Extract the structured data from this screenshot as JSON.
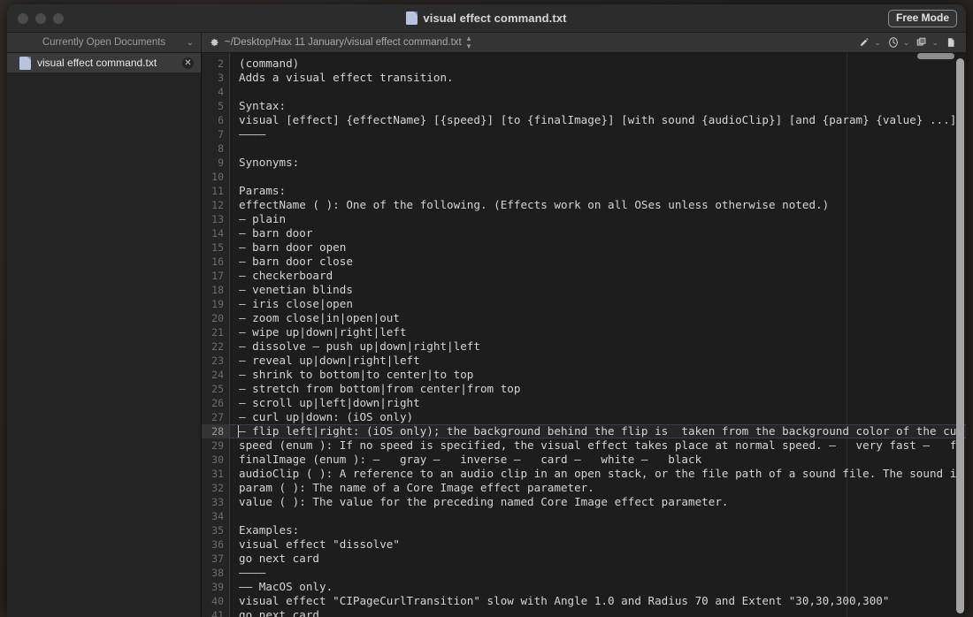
{
  "window": {
    "title": "visual effect command.txt",
    "title_icon": "document-icon",
    "traffic_lights": [
      "close-button",
      "minimize-button",
      "zoom-button"
    ],
    "free_mode_label": "Free Mode"
  },
  "toolbar": {
    "sidebar_header_label": "Currently Open Documents",
    "sidebar_header_chevron": "⌄",
    "gear_icon": "gear-icon",
    "path": "~/Desktop/Hax 11 January/visual effect command.txt",
    "path_stepper": "⌃⌄",
    "icons": [
      {
        "name": "marker-icon",
        "chevron": "⌄"
      },
      {
        "name": "history-clock-icon",
        "chevron": "⌄"
      },
      {
        "name": "copy-windows-icon",
        "chevron": "⌄"
      },
      {
        "name": "new-document-icon",
        "chevron": ""
      }
    ]
  },
  "sidebar": {
    "items": [
      {
        "label": "visual effect command.txt",
        "icon": "document-icon",
        "close": "✕",
        "selected": true
      }
    ]
  },
  "editor": {
    "first_line_number": 2,
    "active_line_number": 28,
    "lines": [
      {
        "n": 2,
        "text": "(command)"
      },
      {
        "n": 3,
        "text": "Adds a visual effect transition."
      },
      {
        "n": 4,
        "text": ""
      },
      {
        "n": 5,
        "text": "Syntax:"
      },
      {
        "n": 6,
        "text": "visual [effect] {effectName} [{speed}] [to {finalImage}] [with sound {audioClip}] [and {param} {value} ...]"
      },
      {
        "n": 7,
        "text": "————"
      },
      {
        "n": 8,
        "text": ""
      },
      {
        "n": 9,
        "text": "Synonyms:"
      },
      {
        "n": 10,
        "text": ""
      },
      {
        "n": 11,
        "text": "Params:"
      },
      {
        "n": 12,
        "text": "effectName ( ): One of the following. (Effects work on all OSes unless otherwise noted.)"
      },
      {
        "n": 13,
        "text": "— plain"
      },
      {
        "n": 14,
        "text": "— barn door"
      },
      {
        "n": 15,
        "text": "— barn door open"
      },
      {
        "n": 16,
        "text": "— barn door close"
      },
      {
        "n": 17,
        "text": "— checkerboard"
      },
      {
        "n": 18,
        "text": "— venetian blinds"
      },
      {
        "n": 19,
        "text": "— iris close|open"
      },
      {
        "n": 20,
        "text": "— zoom close|in|open|out"
      },
      {
        "n": 21,
        "text": "— wipe up|down|right|left"
      },
      {
        "n": 22,
        "text": "— dissolve — push up|down|right|left"
      },
      {
        "n": 23,
        "text": "— reveal up|down|right|left"
      },
      {
        "n": 24,
        "text": "— shrink to bottom|to center|to top"
      },
      {
        "n": 25,
        "text": "— stretch from bottom|from center|from top"
      },
      {
        "n": 26,
        "text": "— scroll up|left|down|right"
      },
      {
        "n": 27,
        "text": "— curl up|down: (iOS only)"
      },
      {
        "n": 28,
        "text": "— flip left|right: (iOS only); the background behind the flip is  taken from the background color of the cu"
      },
      {
        "n": 29,
        "text": "speed (enum ): If no speed is specified, the visual effect takes place at normal speed. —   very fast —   fa"
      },
      {
        "n": 30,
        "text": "finalImage (enum ): —   gray —   inverse —   card —   white —   black"
      },
      {
        "n": 31,
        "text": "audioClip ( ): A reference to an audio clip in an open stack, or the file path of a sound file. The sound is"
      },
      {
        "n": 32,
        "text": "param ( ): The name of a Core Image effect parameter."
      },
      {
        "n": 33,
        "text": "value ( ): The value for the preceding named Core Image effect parameter."
      },
      {
        "n": 34,
        "text": ""
      },
      {
        "n": 35,
        "text": "Examples:"
      },
      {
        "n": 36,
        "text": "visual effect \"dissolve\""
      },
      {
        "n": 37,
        "text": "go next card"
      },
      {
        "n": 38,
        "text": "————"
      },
      {
        "n": 39,
        "text": "—— MacOS only."
      },
      {
        "n": 40,
        "text": "visual effect \"CIPageCurlTransition\" slow with Angle 1.0 and Radius 70 and Extent \"30,30,300,300\""
      },
      {
        "n": 41,
        "text": "go next card"
      }
    ]
  },
  "colors": {
    "window_bg": "#222222",
    "titlebar_bg": "#2c2c2c",
    "toolbar_bg": "#343434",
    "sidebar_bg": "#232323",
    "sidebar_selected_bg": "#3a3a3a",
    "editor_bg": "#1d1d1d",
    "gutter_bg": "#242424",
    "text": "#d4d4d4",
    "line_number": "#6d6d6d",
    "scrollbar": "#a3a3a3",
    "desktop": "#2a2522"
  }
}
